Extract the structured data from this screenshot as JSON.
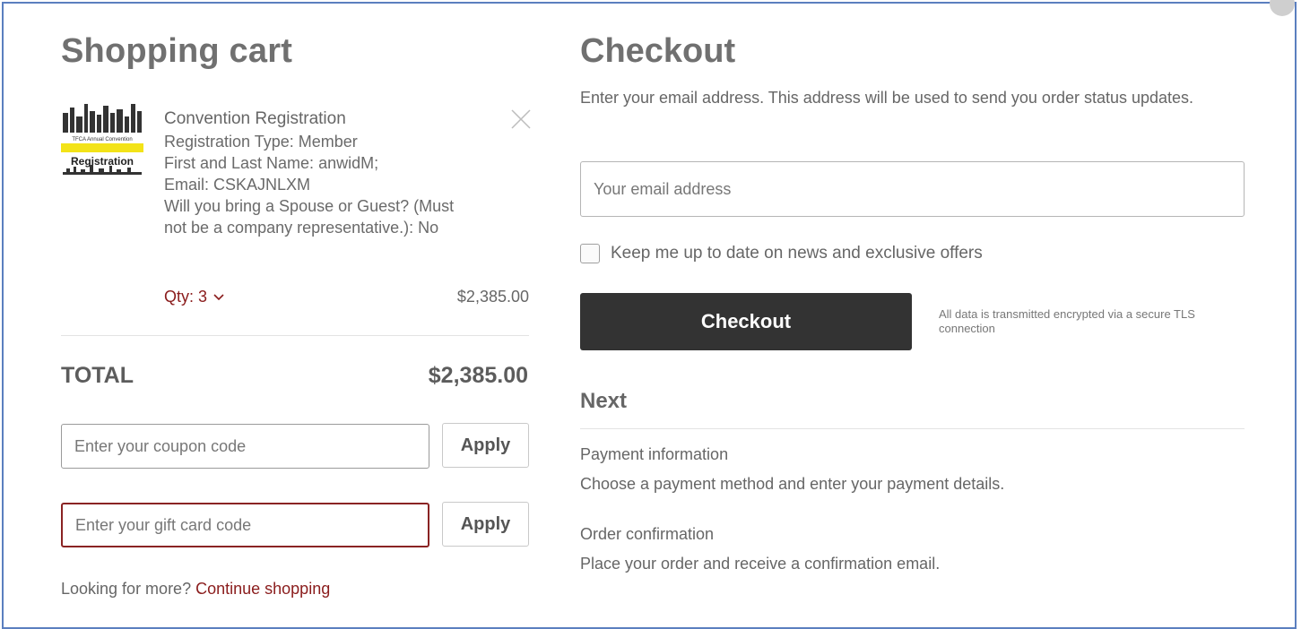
{
  "cart": {
    "title": "Shopping cart",
    "item": {
      "thumbnail_text": {
        "caption": "TFCA Annual Convention",
        "main": "Registration"
      },
      "name": "Convention Registration",
      "details": [
        "Registration Type: Member",
        "First and Last Name: anwidM;",
        "Email: CSKAJNLXM",
        "Will you bring a Spouse or Guest? (Must",
        "not be a company representative.): No"
      ],
      "qty_label": "Qty: 3",
      "price": "$2,385.00"
    },
    "total_label": "TOTAL",
    "total_value": "$2,385.00",
    "coupon_placeholder": "Enter your coupon code",
    "gift_placeholder": "Enter your gift card code",
    "apply_label": "Apply",
    "more_prefix": "Looking for more? ",
    "continue_label": "Continue shopping"
  },
  "checkout": {
    "title": "Checkout",
    "description": "Enter your email address. This address will be used to send you order status updates.",
    "email_placeholder": "Your email address",
    "newsletter_label": "Keep me up to date on news and exclusive offers",
    "button_label": "Checkout",
    "secure_note": "All data is transmitted encrypted via a secure TLS connection",
    "next_title": "Next",
    "steps": [
      {
        "title": "Payment information",
        "desc": "Choose a payment method and enter your payment details."
      },
      {
        "title": "Order confirmation",
        "desc": "Place your order and receive a confirmation email."
      }
    ]
  },
  "colors": {
    "accent": "#8a1c1c",
    "button": "#333333",
    "frame": "#5b7fbf"
  },
  "icons": [
    "close-icon",
    "chevron-down-icon"
  ]
}
